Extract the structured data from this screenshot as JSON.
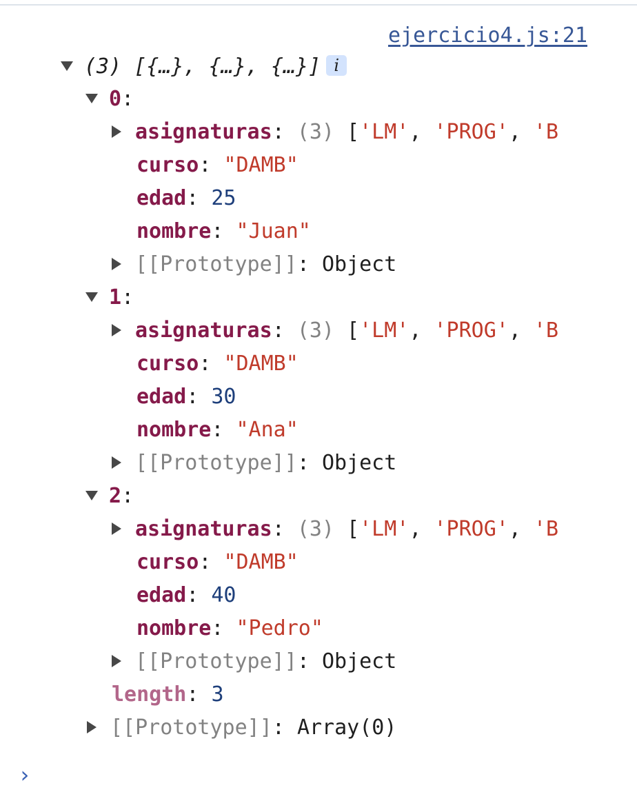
{
  "source_link": "ejercicio4.js:21",
  "summary": {
    "count": "(3)",
    "preview": "[{…}, {…}, {…}]",
    "info_badge": "i"
  },
  "items": [
    {
      "index": "0",
      "asignaturas_count": "(3)",
      "asignaturas_preview": [
        "'LM'",
        "'PROG'",
        "'B"
      ],
      "curso": "\"DAMB\"",
      "edad": "25",
      "nombre": "\"Juan\"",
      "prototype_label": "[[Prototype]]",
      "prototype_value": "Object"
    },
    {
      "index": "1",
      "asignaturas_count": "(3)",
      "asignaturas_preview": [
        "'LM'",
        "'PROG'",
        "'B"
      ],
      "curso": "\"DAMB\"",
      "edad": "30",
      "nombre": "\"Ana\"",
      "prototype_label": "[[Prototype]]",
      "prototype_value": "Object"
    },
    {
      "index": "2",
      "asignaturas_count": "(3)",
      "asignaturas_preview": [
        "'LM'",
        "'PROG'",
        "'B"
      ],
      "curso": "\"DAMB\"",
      "edad": "40",
      "nombre": "\"Pedro\"",
      "prototype_label": "[[Prototype]]",
      "prototype_value": "Object"
    }
  ],
  "keys": {
    "asignaturas": "asignaturas",
    "curso": "curso",
    "edad": "edad",
    "nombre": "nombre"
  },
  "length": {
    "label": "length",
    "value": "3"
  },
  "array_prototype": {
    "label": "[[Prototype]]",
    "value": "Array(0)"
  },
  "prompt_symbol": "›",
  "colors": {
    "key": "#851a4a",
    "string": "#c03b2b",
    "number": "#1e3f7b",
    "link": "#375796",
    "muted": "#828282"
  }
}
